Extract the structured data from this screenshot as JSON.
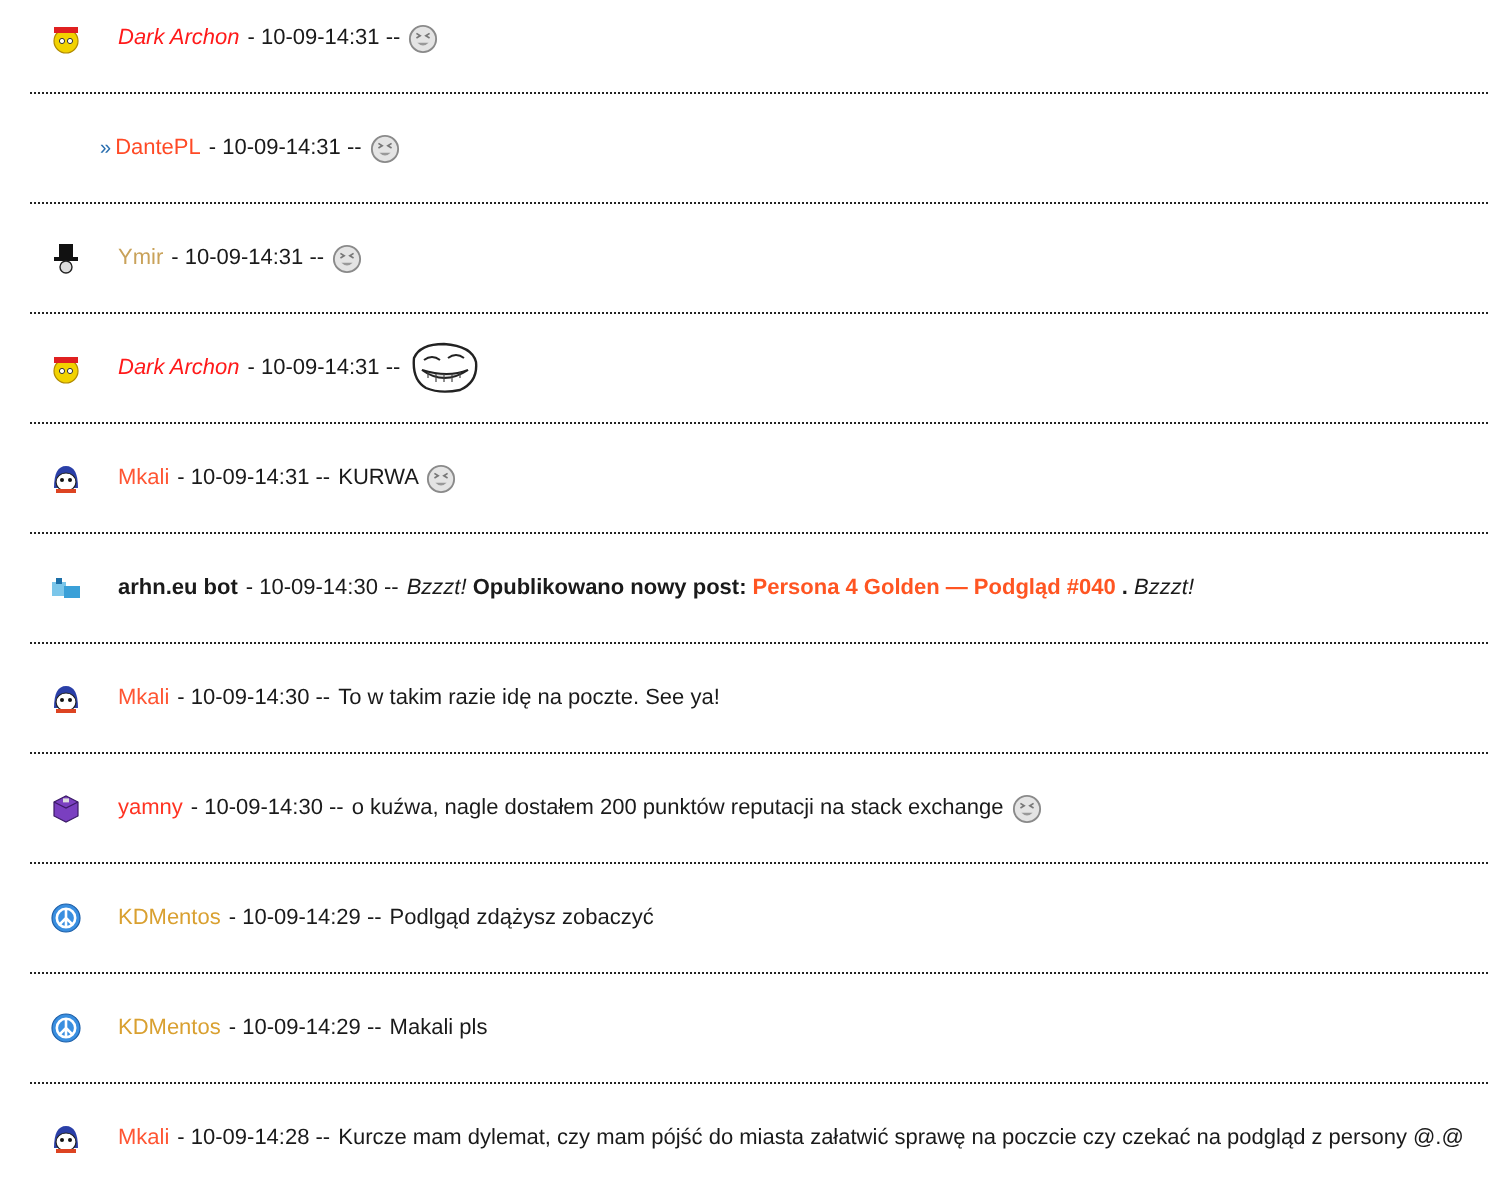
{
  "messages": [
    {
      "avatar": {
        "kind": "chick"
      },
      "reply": false,
      "name": "Dark Archon",
      "italic": true,
      "bold": false,
      "color": "#ff1a1a",
      "meta": "- 10-09-14:31 --",
      "emoticon": {
        "kind": "squint"
      }
    },
    {
      "reply": true,
      "marker": "»",
      "name": "DantePL",
      "italic": false,
      "bold": false,
      "color": "#ff4a26",
      "meta": "- 10-09-14:31 --",
      "emoticon": {
        "kind": "squint"
      }
    },
    {
      "avatar": {
        "kind": "tophat"
      },
      "reply": false,
      "name": "Ymir",
      "italic": false,
      "bold": false,
      "color": "#c9a25a",
      "meta": "- 10-09-14:31 --",
      "emoticon": {
        "kind": "squint"
      }
    },
    {
      "avatar": {
        "kind": "chick"
      },
      "reply": false,
      "name": "Dark Archon",
      "italic": true,
      "bold": false,
      "color": "#ff1a1a",
      "meta": "- 10-09-14:31 --",
      "emoticon": {
        "kind": "troll"
      }
    },
    {
      "avatar": {
        "kind": "mascot"
      },
      "reply": false,
      "name": "Mkali",
      "italic": false,
      "bold": false,
      "color": "#ff5533",
      "meta": "- 10-09-14:31 --",
      "segments": [
        {
          "kind": "plain",
          "text": "KURWA"
        }
      ],
      "emoticon": {
        "kind": "squint"
      }
    },
    {
      "avatar": {
        "kind": "robot"
      },
      "reply": false,
      "name": "arhn.eu bot",
      "italic": false,
      "bold": true,
      "color": "#1a1a1a",
      "meta": "- 10-09-14:30 --",
      "segments": [
        {
          "kind": "italic",
          "text": "Bzzzt!"
        },
        {
          "kind": "bold",
          "text": "Opublikowano nowy post:"
        },
        {
          "kind": "link",
          "text": "Persona 4 Golden — Podgląd #040"
        },
        {
          "kind": "bold",
          "text": "."
        },
        {
          "kind": "italic",
          "text": "Bzzzt!"
        }
      ]
    },
    {
      "avatar": {
        "kind": "mascot"
      },
      "reply": false,
      "name": "Mkali",
      "italic": false,
      "bold": false,
      "color": "#ff5533",
      "meta": "- 10-09-14:30 --",
      "segments": [
        {
          "kind": "plain",
          "text": "To w takim razie idę na poczte. See ya!"
        }
      ]
    },
    {
      "avatar": {
        "kind": "box"
      },
      "reply": false,
      "name": "yamny",
      "italic": false,
      "bold": false,
      "color": "#ff3322",
      "meta": "- 10-09-14:30 --",
      "segments": [
        {
          "kind": "plain",
          "text": "o kuźwa, nagle dostałem 200 punktów reputacji na stack exchange"
        }
      ],
      "emoticon": {
        "kind": "squint"
      }
    },
    {
      "avatar": {
        "kind": "peace"
      },
      "reply": false,
      "name": "KDMentos",
      "italic": false,
      "bold": false,
      "color": "#d9a030",
      "meta": "- 10-09-14:29 --",
      "segments": [
        {
          "kind": "plain",
          "text": "Podlgąd zdążysz zobaczyć"
        }
      ]
    },
    {
      "avatar": {
        "kind": "peace"
      },
      "reply": false,
      "name": "KDMentos",
      "italic": false,
      "bold": false,
      "color": "#d9a030",
      "meta": "- 10-09-14:29 --",
      "segments": [
        {
          "kind": "plain",
          "text": "Makali pls"
        }
      ]
    },
    {
      "avatar": {
        "kind": "mascot"
      },
      "reply": false,
      "name": "Mkali",
      "italic": false,
      "bold": false,
      "color": "#ff5533",
      "meta": "- 10-09-14:28 --",
      "segments": [
        {
          "kind": "plain",
          "text": "Kurcze mam dylemat, czy mam pójść do miasta załatwić sprawę na poczcie czy czekać na podgląd z persony @.@"
        }
      ]
    }
  ]
}
